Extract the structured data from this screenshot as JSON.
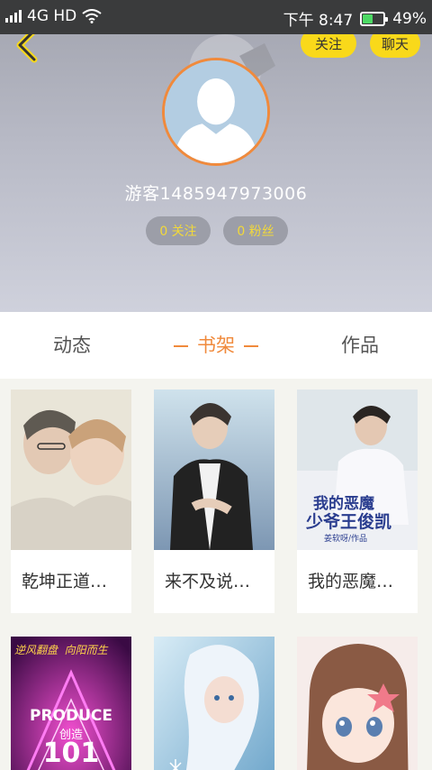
{
  "status_bar": {
    "network": "4G HD",
    "time": "下午 8:47",
    "battery": "49%",
    "battery_level": 0.49
  },
  "header": {
    "follow_button": "关注",
    "chat_button": "聊天",
    "username": "游客1485947973006",
    "following_count": "0 关注",
    "fans_count": "0 粉丝"
  },
  "tabs": [
    {
      "label": "动态"
    },
    {
      "label": "书架",
      "active": true
    },
    {
      "label": "作品"
    }
  ],
  "books": [
    {
      "title": "乾坤正道…",
      "icon": "book-cover-illustration"
    },
    {
      "title": "来不及说…",
      "icon": "book-cover-photo"
    },
    {
      "title": "我的恶魔…",
      "icon": "book-cover-photo",
      "cover_text": "我的恶魔",
      "cover_text2": "少爷王俊凯",
      "cover_text3": "姜软呀/作品"
    },
    {
      "cover_text": "逆风翻盘  向阳而生",
      "cover_text2": "PRODUCE",
      "cover_text3": "101",
      "cover_text4": "创造"
    },
    {
      "icon": "book-cover-anime"
    },
    {
      "icon": "book-cover-anime"
    }
  ],
  "colors": {
    "accent": "#f08a3c",
    "button_yellow": "#f9d91a",
    "pill_text": "#f2d93a"
  }
}
